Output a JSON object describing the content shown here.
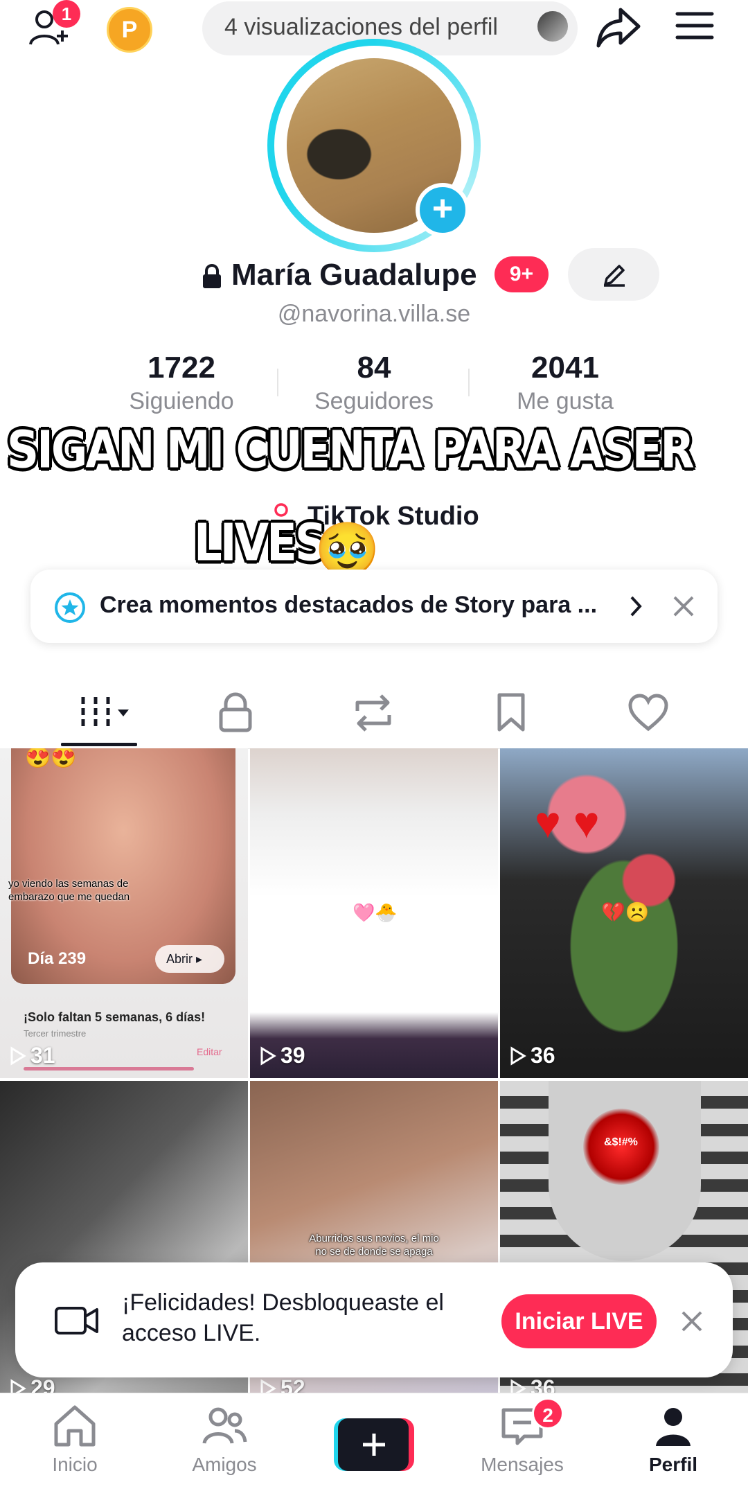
{
  "top_bar": {
    "friend_requests_badge": "1",
    "coin_letter": "P",
    "profile_views_text": "4 visualizaciones del perfil"
  },
  "profile": {
    "name": "María Guadalupe",
    "notification_badge": "9+",
    "handle": "@navorina.villa.se",
    "stats": [
      {
        "value": "1722",
        "label": "Siguiendo"
      },
      {
        "value": "84",
        "label": "Seguidores"
      },
      {
        "value": "2041",
        "label": "Me gusta"
      }
    ],
    "studio_label": "TikTok Studio"
  },
  "overlay_caption": {
    "line1": "SIGAN MI CUENTA PARA ASER",
    "line2": "LIVES",
    "emoji": "🥹"
  },
  "story_banner": {
    "text": "Crea momentos destacados de Story para ..."
  },
  "tabs": [
    "videos",
    "private",
    "reposts",
    "favorites",
    "liked"
  ],
  "videos": [
    {
      "views": "31",
      "overlay_lines": [
        "yo viendo las semanas de",
        "embarazo que me quedan"
      ],
      "day_label": "Día 239",
      "open_label": "Abrir",
      "weeks_text": "¡Solo faltan 5 semanas, 6 días!",
      "trimester": "Tercer trimestre",
      "edit_label": "Editar",
      "emoji_top": "😍😍"
    },
    {
      "views": "39",
      "emoji_center": "🩷🐣"
    },
    {
      "views": "36",
      "emoji_center": "💔☹️"
    },
    {
      "views": "29"
    },
    {
      "views": "52",
      "overlay_lines": [
        "Aburridos sus novios, el mio",
        "no se de donde se apaga"
      ]
    },
    {
      "views": "36",
      "mask_text": "&$!#%"
    }
  ],
  "live_banner": {
    "text": "¡Felicidades! Desbloqueaste el acceso LIVE.",
    "button": "Iniciar LIVE"
  },
  "bottom_nav": {
    "items": [
      "Inicio",
      "Amigos",
      "Mensajes",
      "Perfil"
    ],
    "messages_badge": "2"
  },
  "colors": {
    "accent": "#fe2c55",
    "ring": "#20d5ec",
    "text": "#161823",
    "muted": "#8a8b91"
  }
}
